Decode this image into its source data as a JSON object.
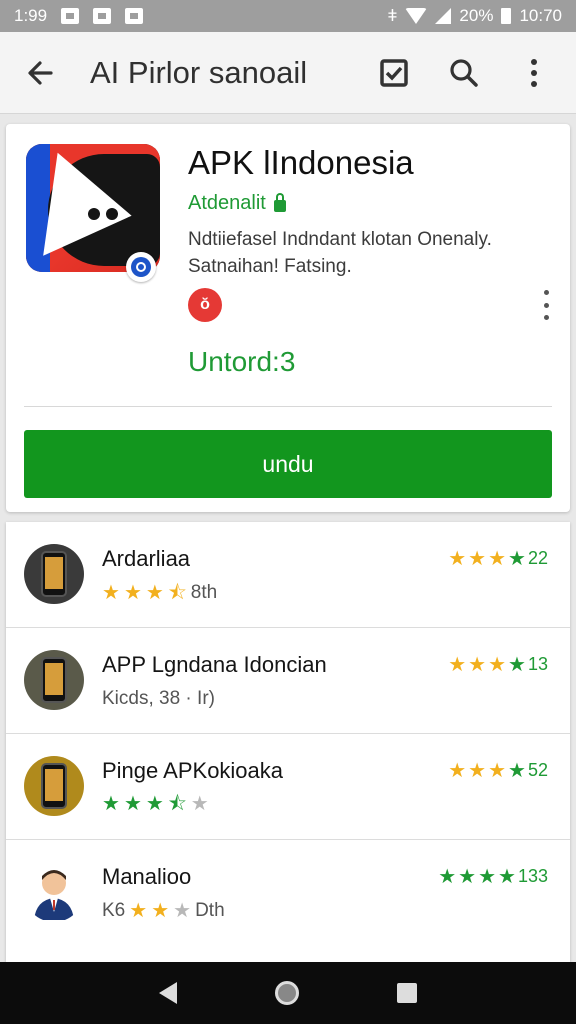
{
  "status_bar": {
    "time_left": "1:99",
    "battery_text": "20%",
    "time_right": "10:70"
  },
  "toolbar": {
    "title": "AI Pirlor sanoail",
    "icons": [
      "back-arrow-icon",
      "checkbox-icon",
      "search-icon",
      "more-vert-icon"
    ]
  },
  "app": {
    "name": "APK lIndonesia",
    "developer": "Atdenalit",
    "description_line1": "Ndtiiefasel Indndant klotan Onenaly.",
    "description_line2": "Satnaihan! Fatsing.",
    "rating_badge": "ŏ",
    "installs": "Untord:3",
    "install_button": "undu"
  },
  "list": [
    {
      "name": "Ardarliaa",
      "sub_text": "8th",
      "sub_stars": {
        "full": 3,
        "half": 1,
        "empty": 0,
        "color": "#f2b01e"
      },
      "right_value": "22",
      "right_stars_color": "#f2b01e",
      "thumb": "phone-icon"
    },
    {
      "name": "APP Lgndana Idoncian",
      "sub_text": "Kicds, 38 · Ir)",
      "sub_stars": null,
      "right_value": "13",
      "right_stars_color": "#f2b01e",
      "thumb": "phone-icon"
    },
    {
      "name": "Pinge APKokioaka",
      "sub_text": "",
      "sub_stars": {
        "full": 3,
        "half": 1,
        "empty": 1,
        "color": "#1f9a35"
      },
      "right_value": "52",
      "right_stars_color": "#f2b01e",
      "thumb": "phone-icon"
    },
    {
      "name": "Manalioo",
      "sub_text_prefix": "K6",
      "sub_text": "Dth",
      "sub_stars": {
        "full": 2,
        "half": 0,
        "empty": 1,
        "color": "#f2b01e"
      },
      "right_value": "133",
      "right_stars_color": "#1f9a35",
      "thumb": "avatar-icon"
    }
  ],
  "colors": {
    "accent_green": "#1f9a35",
    "install_green": "#12961e",
    "star_yellow": "#f2b01e",
    "icon_red": "#e8362b"
  }
}
